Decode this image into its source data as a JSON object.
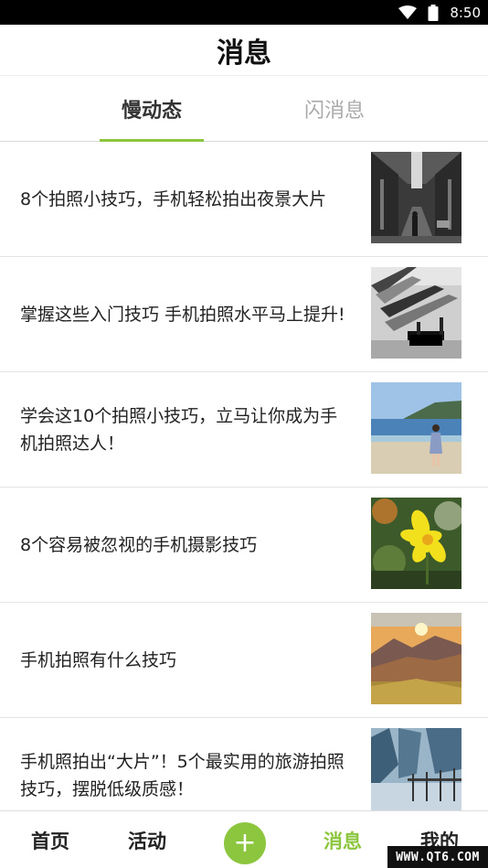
{
  "status_bar": {
    "time": "8:50",
    "icons": [
      "wifi-icon",
      "battery-icon"
    ]
  },
  "header": {
    "title": "消息"
  },
  "tabs": [
    {
      "label": "慢动态",
      "active": true
    },
    {
      "label": "闪消息",
      "active": false
    }
  ],
  "articles": [
    {
      "title": "8个拍照小技巧，手机轻松拍出夜景大片",
      "thumbnail": "night-street-photo"
    },
    {
      "title": "掌握这些入门技巧 手机拍照水平马上提升!",
      "thumbnail": "bw-bench-photo"
    },
    {
      "title": "学会这10个拍照小技巧，立马让你成为手机拍照达人！",
      "thumbnail": "beach-girl-photo"
    },
    {
      "title": "8个容易被忽视的手机摄影技巧",
      "thumbnail": "yellow-flower-photo"
    },
    {
      "title": "手机拍照有什么技巧",
      "thumbnail": "sunset-mountain-photo"
    },
    {
      "title": "手机照拍出“大片”！5个最实用的旅游拍照技巧，摆脱低级质感！",
      "thumbnail": "winter-trees-photo"
    }
  ],
  "bottom_nav": {
    "home": "首页",
    "activity": "活动",
    "add": "+",
    "messages": "消息",
    "mine": "我的",
    "active": "messages"
  },
  "watermark": "WWW.QT6.COM",
  "colors": {
    "accent": "#8cc63f",
    "inactive_tab": "#aaaaaa",
    "status_bar": "#000000"
  }
}
